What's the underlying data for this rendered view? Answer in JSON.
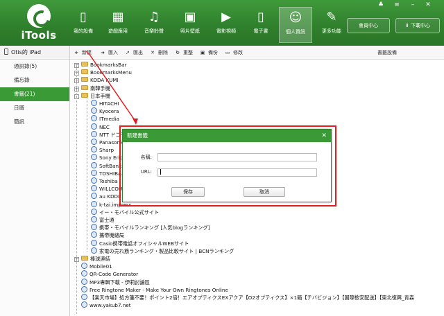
{
  "app": {
    "logo_text": "iTools"
  },
  "header": {
    "nav": [
      {
        "label": "我的設備",
        "icon": "phone-icon"
      },
      {
        "label": "遊戲應用",
        "icon": "apps-grid-icon"
      },
      {
        "label": "音樂鈴聲",
        "icon": "music-note-icon"
      },
      {
        "label": "照片壁紙",
        "icon": "photo-icon"
      },
      {
        "label": "電影視頻",
        "icon": "play-icon"
      },
      {
        "label": "電子書",
        "icon": "book-icon"
      },
      {
        "label": "個人資訊",
        "icon": "person-icon"
      },
      {
        "label": "更多功能",
        "icon": "wrench-icon"
      }
    ],
    "member_label": "會員中心",
    "download_label": "下載中心"
  },
  "sidebar": {
    "device_name": "Otis的 iPad",
    "items": [
      {
        "label": "通訊錄(5)"
      },
      {
        "label": "備忘錄"
      },
      {
        "label": "書籤(21)"
      },
      {
        "label": "日曆"
      },
      {
        "label": "簡訊"
      }
    ]
  },
  "toolbar": {
    "new": "新建",
    "import": "匯入",
    "export": "匯出",
    "delete": "刪除",
    "refresh": "重整",
    "backup": "備份",
    "edit": "修改",
    "right": "書籤設備"
  },
  "tree": [
    {
      "label": "BookmarksBar",
      "type": "folder",
      "level": 0,
      "expander": "+"
    },
    {
      "label": "BookmarksMenu",
      "type": "folder",
      "level": 0,
      "expander": "+"
    },
    {
      "label": "KODA KUMI",
      "type": "folder",
      "level": 0,
      "expander": "+"
    },
    {
      "label": "南韓手機",
      "type": "folder",
      "level": 0,
      "expander": "+"
    },
    {
      "label": "日本手機",
      "type": "folder",
      "level": 0,
      "expander": "-"
    },
    {
      "label": "HITACHI",
      "type": "bm",
      "level": 1
    },
    {
      "label": "Kyocera",
      "type": "bm",
      "level": 1
    },
    {
      "label": "ITmedia",
      "type": "bm",
      "level": 1
    },
    {
      "label": "NEC",
      "type": "bm",
      "level": 1
    },
    {
      "label": "NTT ドコモ",
      "type": "bm",
      "level": 1
    },
    {
      "label": "Panasonic",
      "type": "bm",
      "level": 1
    },
    {
      "label": "Sharp",
      "type": "bm",
      "level": 1
    },
    {
      "label": "Sony Ericsson",
      "type": "bm",
      "level": 1
    },
    {
      "label": "SoftBank",
      "type": "bm",
      "level": 1
    },
    {
      "label": "TOSHIBA",
      "type": "bm",
      "level": 1
    },
    {
      "label": "Toshiba",
      "type": "bm",
      "level": 1
    },
    {
      "label": "WILLCOM",
      "type": "bm",
      "level": 1
    },
    {
      "label": "au KDDI",
      "type": "bm",
      "level": 1
    },
    {
      "label": "k-tai.impress",
      "type": "bm",
      "level": 1
    },
    {
      "label": "イー・モバイル公式サイト",
      "type": "bm",
      "level": 1
    },
    {
      "label": "富士通",
      "type": "bm",
      "level": 1
    },
    {
      "label": "携帯・モバイルランキング [人気blogランキング]",
      "type": "bm",
      "level": 1
    },
    {
      "label": "攜帶機總局",
      "type": "bm",
      "level": 1
    },
    {
      "label": "Casio携帯電話オフィシャルWEBサイト",
      "type": "bm",
      "level": 1
    },
    {
      "label": "家電の売れ筋ランキング・製品比較サイト | BCNランキング",
      "type": "bm",
      "level": 1
    },
    {
      "label": "棒球連結",
      "type": "folder",
      "level": 0,
      "expander": "+"
    },
    {
      "label": "Mobile01",
      "type": "bm",
      "level": 0
    },
    {
      "label": "QR-Code Generator",
      "type": "bm",
      "level": 0
    },
    {
      "label": "MP3專輯下載 - 伊莉討論區",
      "type": "bm",
      "level": 0
    },
    {
      "label": "Free Ringtone Maker - Make Your Own Ringtones Online",
      "type": "bm",
      "level": 0
    },
    {
      "label": "【楽天市場】処方箋不要！ポイント2倍！エアオプティクスEXアクア【O2オプティクス】×1箱【チバビジョン】【国際檢安配送】【東北復興_青森",
      "type": "bm",
      "level": 0
    },
    {
      "label": "www.yakub7.net",
      "type": "bm",
      "level": 0
    }
  ],
  "dialog": {
    "title": "新建書籤",
    "close": "✕",
    "name_label": "名稱:",
    "name_value": "",
    "url_label": "URL:",
    "url_value": "",
    "save": "保存",
    "cancel": "取消"
  },
  "colors": {
    "brand": "#2f7f2c",
    "highlight": "#e11e1e"
  }
}
